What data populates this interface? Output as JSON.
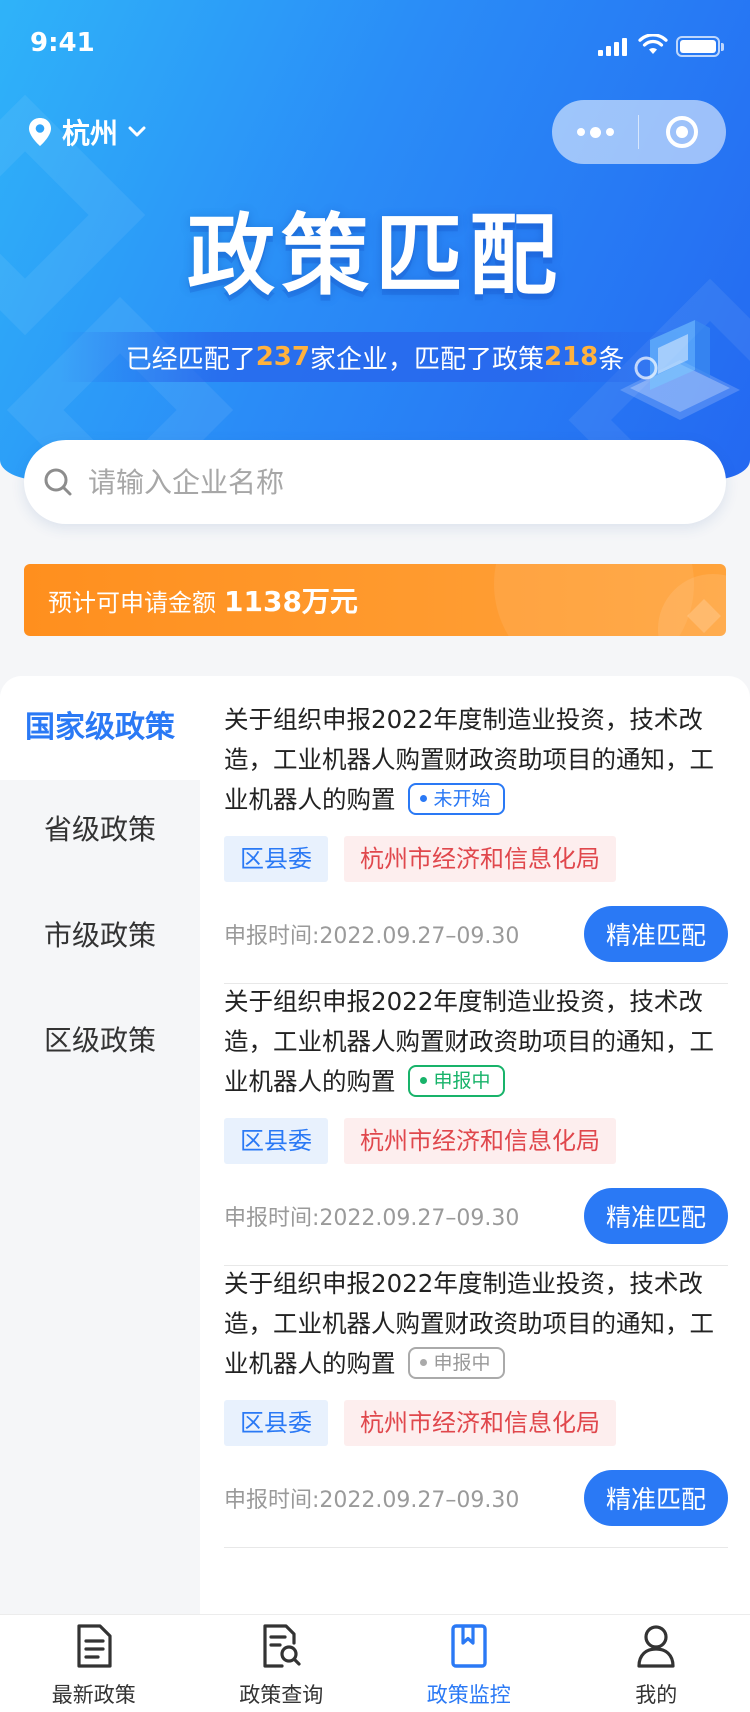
{
  "status_bar": {
    "time": "9:41"
  },
  "header": {
    "city": "杭州",
    "title": "政策匹配",
    "stats": {
      "prefix": "已经匹配了",
      "enterprise_count": "237",
      "middle": "家企业，匹配了政策",
      "policy_count": "218",
      "suffix": "条"
    }
  },
  "search": {
    "placeholder": "请输入企业名称",
    "value": ""
  },
  "amount_banner": {
    "label": "预计可申请金额",
    "value": "1138万元"
  },
  "sidebar": {
    "items": [
      {
        "label": "国家级政策",
        "active": true
      },
      {
        "label": "省级政策",
        "active": false
      },
      {
        "label": "市级政策",
        "active": false
      },
      {
        "label": "区级政策",
        "active": false
      }
    ]
  },
  "policies": [
    {
      "title": "关于组织申报2022年度制造业投资，技术改造，工业机器人购置财政资助项目的通知，工业机器人的购置",
      "status": "未开始",
      "status_color": "#2a79f5",
      "tags": [
        "区县委",
        "杭州市经济和信息化局"
      ],
      "time_label": "申报时间:",
      "time": "2022.09.27–09.30",
      "button": "精准匹配"
    },
    {
      "title": "关于组织申报2022年度制造业投资，技术改造，工业机器人购置财政资助项目的通知，工业机器人的购置",
      "status": "申报中",
      "status_color": "#18b36a",
      "tags": [
        "区县委",
        "杭州市经济和信息化局"
      ],
      "time_label": "申报时间:",
      "time": "2022.09.27–09.30",
      "button": "精准匹配"
    },
    {
      "title": "关于组织申报2022年度制造业投资，技术改造，工业机器人购置财政资助项目的通知，工业机器人的购置",
      "status": "申报中",
      "status_color": "#999999",
      "tags": [
        "区县委",
        "杭州市经济和信息化局"
      ],
      "time_label": "申报时间:",
      "time": "2022.09.27–09.30",
      "button": "精准匹配"
    }
  ],
  "tabbar": {
    "items": [
      {
        "label": "最新政策",
        "icon": "document-icon",
        "active": false
      },
      {
        "label": "政策查询",
        "icon": "document-search-icon",
        "active": false
      },
      {
        "label": "政策监控",
        "icon": "bookmark-book-icon",
        "active": true
      },
      {
        "label": "我的",
        "icon": "user-icon",
        "active": false
      }
    ]
  },
  "colors": {
    "primary": "#2a79f5",
    "accent_orange": "#ff8f1e",
    "stat_highlight": "#ffb23e",
    "tag_red": "#e0474c"
  }
}
